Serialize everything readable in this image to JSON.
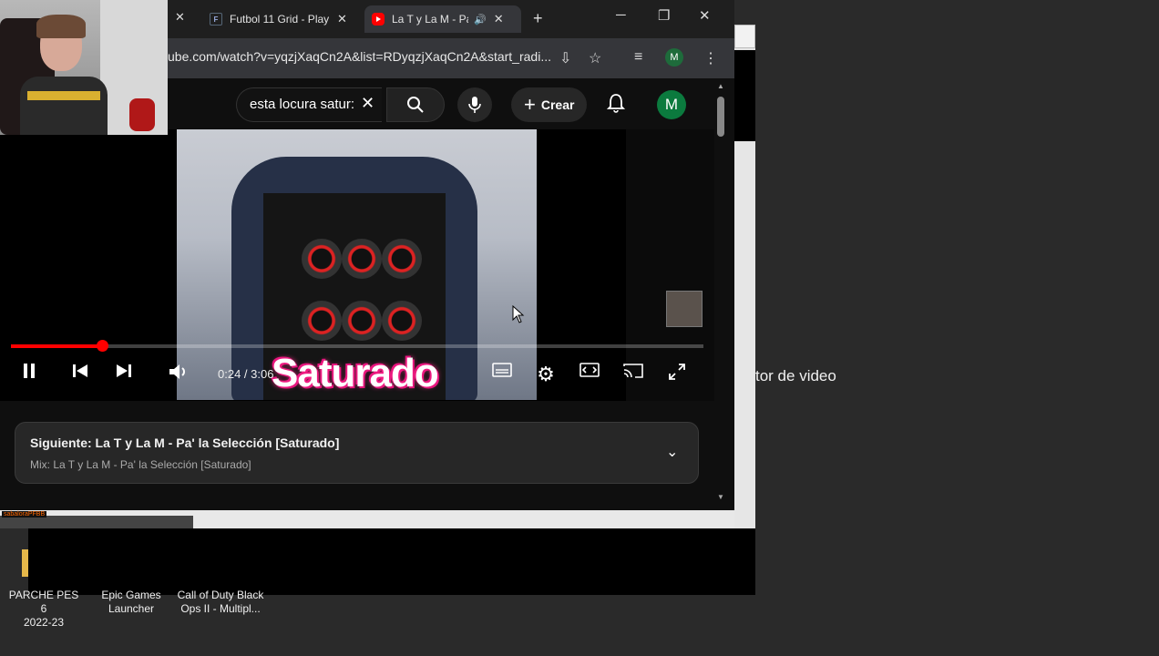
{
  "tabs": [
    {
      "label": "Futbol 11 Grid - Play",
      "favicon": "futbol-grid-icon"
    },
    {
      "label": "La T y La M - Pa' la Selección",
      "favicon": "youtube-icon",
      "active": true
    }
  ],
  "window_controls": {
    "minimize": "─",
    "maximize": "❐",
    "close": "✕",
    "new_tab": "+"
  },
  "address_bar": {
    "url": "ube.com/watch?v=yqzjXaqCn2A&list=RDyqzjXaqCn2A&start_radi..."
  },
  "profile_initial": "M",
  "youtube_header": {
    "search_value": "esta locura satur:",
    "create_label": "Crear",
    "avatar_initial": "M"
  },
  "player": {
    "current_time": "0:24",
    "duration": "3:06",
    "time_display": "0:24 / 3:06",
    "progress": 0.132,
    "overlay_caption": "Saturado"
  },
  "up_next": {
    "title": "Siguiente: La T y La M - Pa' la Selección [Saturado]",
    "subtitle": "Mix: La T y La M - Pa' la Selección [Saturado]"
  },
  "side_window": {
    "text": "tor de video"
  },
  "mini_label": "sabaloraPFBB",
  "desktop_icons": [
    {
      "label1": "PARCHE PES 6",
      "label2": "2022-23"
    },
    {
      "label1": "Epic Games",
      "label2": "Launcher"
    },
    {
      "label1": "Call of Duty Black",
      "label2": "Ops II - Multipl..."
    }
  ],
  "colors": {
    "accent_red": "#ff0000",
    "yt_bg": "#0f0f0f",
    "avatar_green": "#0b7a3e"
  }
}
